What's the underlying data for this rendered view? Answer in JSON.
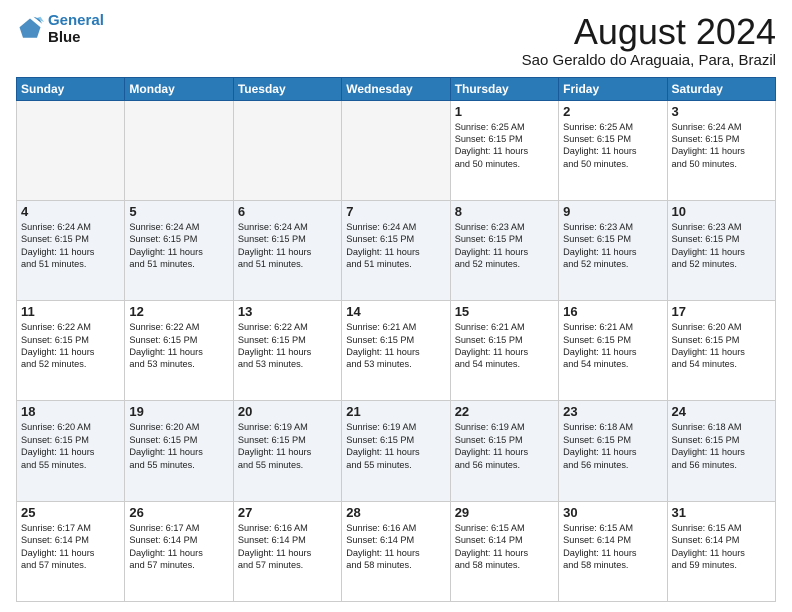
{
  "logo": {
    "line1": "General",
    "line2": "Blue"
  },
  "title": "August 2024",
  "subtitle": "Sao Geraldo do Araguaia, Para, Brazil",
  "days_of_week": [
    "Sunday",
    "Monday",
    "Tuesday",
    "Wednesday",
    "Thursday",
    "Friday",
    "Saturday"
  ],
  "weeks": [
    [
      {
        "day": "",
        "text": "",
        "empty": true
      },
      {
        "day": "",
        "text": "",
        "empty": true
      },
      {
        "day": "",
        "text": "",
        "empty": true
      },
      {
        "day": "",
        "text": "",
        "empty": true
      },
      {
        "day": "1",
        "text": "Sunrise: 6:25 AM\nSunset: 6:15 PM\nDaylight: 11 hours\nand 50 minutes."
      },
      {
        "day": "2",
        "text": "Sunrise: 6:25 AM\nSunset: 6:15 PM\nDaylight: 11 hours\nand 50 minutes."
      },
      {
        "day": "3",
        "text": "Sunrise: 6:24 AM\nSunset: 6:15 PM\nDaylight: 11 hours\nand 50 minutes."
      }
    ],
    [
      {
        "day": "4",
        "text": "Sunrise: 6:24 AM\nSunset: 6:15 PM\nDaylight: 11 hours\nand 51 minutes."
      },
      {
        "day": "5",
        "text": "Sunrise: 6:24 AM\nSunset: 6:15 PM\nDaylight: 11 hours\nand 51 minutes."
      },
      {
        "day": "6",
        "text": "Sunrise: 6:24 AM\nSunset: 6:15 PM\nDaylight: 11 hours\nand 51 minutes."
      },
      {
        "day": "7",
        "text": "Sunrise: 6:24 AM\nSunset: 6:15 PM\nDaylight: 11 hours\nand 51 minutes."
      },
      {
        "day": "8",
        "text": "Sunrise: 6:23 AM\nSunset: 6:15 PM\nDaylight: 11 hours\nand 52 minutes."
      },
      {
        "day": "9",
        "text": "Sunrise: 6:23 AM\nSunset: 6:15 PM\nDaylight: 11 hours\nand 52 minutes."
      },
      {
        "day": "10",
        "text": "Sunrise: 6:23 AM\nSunset: 6:15 PM\nDaylight: 11 hours\nand 52 minutes."
      }
    ],
    [
      {
        "day": "11",
        "text": "Sunrise: 6:22 AM\nSunset: 6:15 PM\nDaylight: 11 hours\nand 52 minutes."
      },
      {
        "day": "12",
        "text": "Sunrise: 6:22 AM\nSunset: 6:15 PM\nDaylight: 11 hours\nand 53 minutes."
      },
      {
        "day": "13",
        "text": "Sunrise: 6:22 AM\nSunset: 6:15 PM\nDaylight: 11 hours\nand 53 minutes."
      },
      {
        "day": "14",
        "text": "Sunrise: 6:21 AM\nSunset: 6:15 PM\nDaylight: 11 hours\nand 53 minutes."
      },
      {
        "day": "15",
        "text": "Sunrise: 6:21 AM\nSunset: 6:15 PM\nDaylight: 11 hours\nand 54 minutes."
      },
      {
        "day": "16",
        "text": "Sunrise: 6:21 AM\nSunset: 6:15 PM\nDaylight: 11 hours\nand 54 minutes."
      },
      {
        "day": "17",
        "text": "Sunrise: 6:20 AM\nSunset: 6:15 PM\nDaylight: 11 hours\nand 54 minutes."
      }
    ],
    [
      {
        "day": "18",
        "text": "Sunrise: 6:20 AM\nSunset: 6:15 PM\nDaylight: 11 hours\nand 55 minutes."
      },
      {
        "day": "19",
        "text": "Sunrise: 6:20 AM\nSunset: 6:15 PM\nDaylight: 11 hours\nand 55 minutes."
      },
      {
        "day": "20",
        "text": "Sunrise: 6:19 AM\nSunset: 6:15 PM\nDaylight: 11 hours\nand 55 minutes."
      },
      {
        "day": "21",
        "text": "Sunrise: 6:19 AM\nSunset: 6:15 PM\nDaylight: 11 hours\nand 55 minutes."
      },
      {
        "day": "22",
        "text": "Sunrise: 6:19 AM\nSunset: 6:15 PM\nDaylight: 11 hours\nand 56 minutes."
      },
      {
        "day": "23",
        "text": "Sunrise: 6:18 AM\nSunset: 6:15 PM\nDaylight: 11 hours\nand 56 minutes."
      },
      {
        "day": "24",
        "text": "Sunrise: 6:18 AM\nSunset: 6:15 PM\nDaylight: 11 hours\nand 56 minutes."
      }
    ],
    [
      {
        "day": "25",
        "text": "Sunrise: 6:17 AM\nSunset: 6:14 PM\nDaylight: 11 hours\nand 57 minutes."
      },
      {
        "day": "26",
        "text": "Sunrise: 6:17 AM\nSunset: 6:14 PM\nDaylight: 11 hours\nand 57 minutes."
      },
      {
        "day": "27",
        "text": "Sunrise: 6:16 AM\nSunset: 6:14 PM\nDaylight: 11 hours\nand 57 minutes."
      },
      {
        "day": "28",
        "text": "Sunrise: 6:16 AM\nSunset: 6:14 PM\nDaylight: 11 hours\nand 58 minutes."
      },
      {
        "day": "29",
        "text": "Sunrise: 6:15 AM\nSunset: 6:14 PM\nDaylight: 11 hours\nand 58 minutes."
      },
      {
        "day": "30",
        "text": "Sunrise: 6:15 AM\nSunset: 6:14 PM\nDaylight: 11 hours\nand 58 minutes."
      },
      {
        "day": "31",
        "text": "Sunrise: 6:15 AM\nSunset: 6:14 PM\nDaylight: 11 hours\nand 59 minutes."
      }
    ]
  ]
}
